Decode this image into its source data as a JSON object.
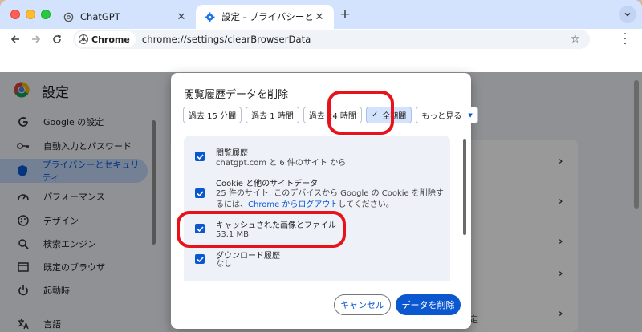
{
  "tabs": [
    {
      "title": "ChatGPT",
      "icon": "chatgpt-icon"
    },
    {
      "title": "設定 - プライバシーとセキュリティ",
      "icon": "settings-gear-icon"
    }
  ],
  "toolbar": {
    "chip_label": "Chrome",
    "url": "chrome://settings/clearBrowserData"
  },
  "settings": {
    "title": "設定",
    "sidebar": [
      {
        "label": "Google の設定",
        "icon": "google-g-icon"
      },
      {
        "label": "自動入力とパスワード",
        "icon": "key-icon"
      },
      {
        "label": "プライバシーとセキュリティ",
        "icon": "shield-icon",
        "active": true
      },
      {
        "label": "パフォーマンス",
        "icon": "speedometer-icon"
      },
      {
        "label": "デザイン",
        "icon": "palette-icon"
      },
      {
        "label": "検索エンジン",
        "icon": "search-icon"
      },
      {
        "label": "既定のブラウザ",
        "icon": "browser-icon"
      },
      {
        "label": "起動時",
        "icon": "power-icon"
      },
      {
        "label": "言語",
        "icon": "translate-icon"
      }
    ],
    "bottom_fragment": "定"
  },
  "dialog": {
    "title": "閲覧履歴データを削除",
    "ranges": [
      {
        "label": "過去 15 分間"
      },
      {
        "label": "過去 1 時間"
      },
      {
        "label": "過去 24 時間"
      },
      {
        "label": "全期間",
        "selected": true
      },
      {
        "label": "もっと見る"
      }
    ],
    "items": [
      {
        "title": "閲覧履歴",
        "subtitle": "chatgpt.com と 6 件のサイト から",
        "checked": true
      },
      {
        "title": "Cookie と他のサイトデータ",
        "subtitle_pre": "25 件のサイト. このデバイスから Google の Cookie を削除するには、",
        "subtitle_link": "Chrome からログアウト",
        "subtitle_post": "してください。",
        "checked": true
      },
      {
        "title": "キャッシュされた画像とファイル",
        "subtitle": "53.1 MB",
        "checked": true
      },
      {
        "title": "ダウンロード履歴",
        "subtitle": "なし",
        "checked": true
      }
    ],
    "cancel_label": "キャンセル",
    "delete_label": "データを削除"
  },
  "colors": {
    "accent": "#0b57d0",
    "annotation": "#e8121a",
    "tabstrip": "#d3e3fd"
  }
}
